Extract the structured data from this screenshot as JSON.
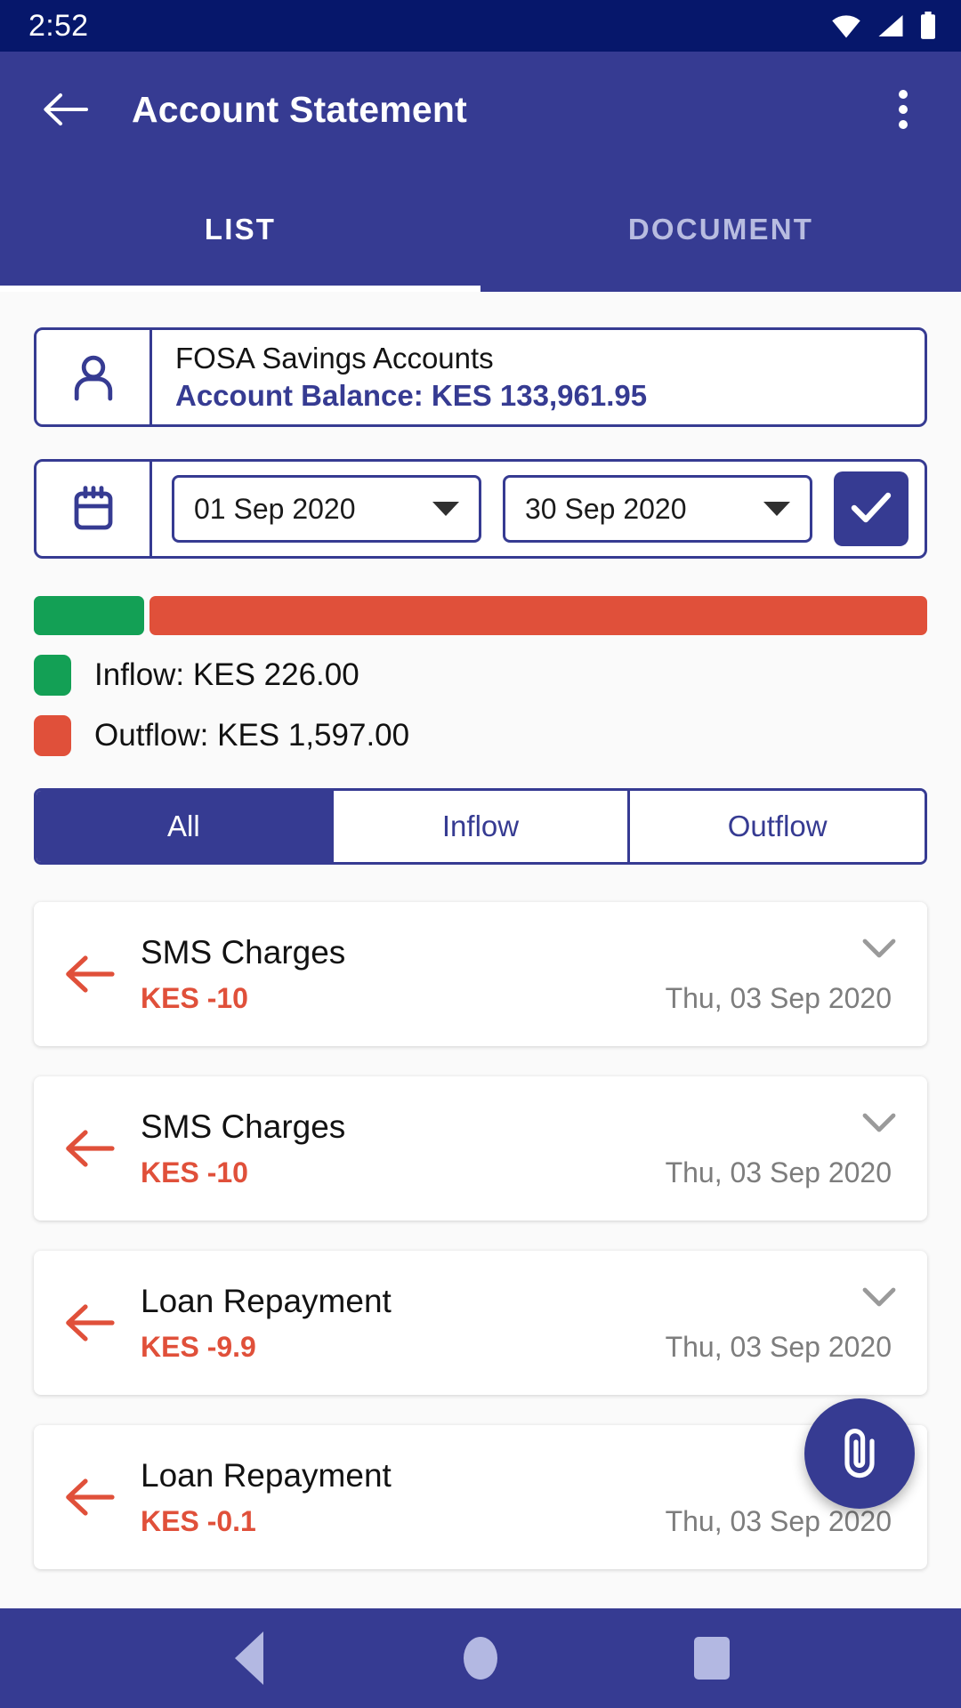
{
  "status_bar": {
    "time": "2:52",
    "icons": [
      "wifi-icon",
      "cellular-signal-icon",
      "battery-icon"
    ]
  },
  "app_bar": {
    "back_icon": "arrow-left-icon",
    "title": "Account Statement",
    "overflow_icon": "more-vertical-icon"
  },
  "tabs": [
    {
      "label": "LIST",
      "active": true
    },
    {
      "label": "DOCUMENT",
      "active": false
    }
  ],
  "account": {
    "icon": "person-icon",
    "name": "FOSA Savings Accounts",
    "balance_label": "Account Balance: KES 133,961.95"
  },
  "date_range": {
    "icon": "calendar-icon",
    "from": "01 Sep 2020",
    "to": "30 Sep 2020",
    "confirm_icon": "check-icon"
  },
  "summary": {
    "inflow_label": "Inflow: KES 226.00",
    "outflow_label": "Outflow: KES 1,597.00",
    "inflow_color": "#13a055",
    "outflow_color": "#e0503a",
    "inflow_pct": 12.4,
    "outflow_pct": 87.6
  },
  "filters": [
    {
      "label": "All",
      "active": true
    },
    {
      "label": "Inflow",
      "active": false
    },
    {
      "label": "Outflow",
      "active": false
    }
  ],
  "transactions": [
    {
      "title": "SMS Charges",
      "amount": "KES -10",
      "date": "Thu, 03 Sep 2020"
    },
    {
      "title": "SMS Charges",
      "amount": "KES -10",
      "date": "Thu, 03 Sep 2020"
    },
    {
      "title": "Loan Repayment",
      "amount": "KES -9.9",
      "date": "Thu, 03 Sep 2020"
    },
    {
      "title": "Loan Repayment",
      "amount": "KES -0.1",
      "date": "Thu, 03 Sep 2020"
    }
  ],
  "fab": {
    "icon": "attachment-paperclip-icon"
  },
  "nav_bar": {
    "back": "back-triangle-icon",
    "home": "home-circle-icon",
    "recents": "recents-square-icon"
  },
  "theme": {
    "status_bar_bg": "#06176b",
    "primary": "#363b92",
    "accent_red": "#e0503a",
    "accent_green": "#13a055"
  },
  "chart_data": {
    "type": "bar",
    "title": "Inflow vs Outflow",
    "categories": [
      "Inflow",
      "Outflow"
    ],
    "values": [
      226.0,
      1597.0
    ],
    "colors": [
      "#13a055",
      "#e0503a"
    ],
    "unit": "KES",
    "orientation": "horizontal-stacked",
    "legend": [
      "Inflow: KES 226.00",
      "Outflow: KES 1,597.00"
    ]
  }
}
